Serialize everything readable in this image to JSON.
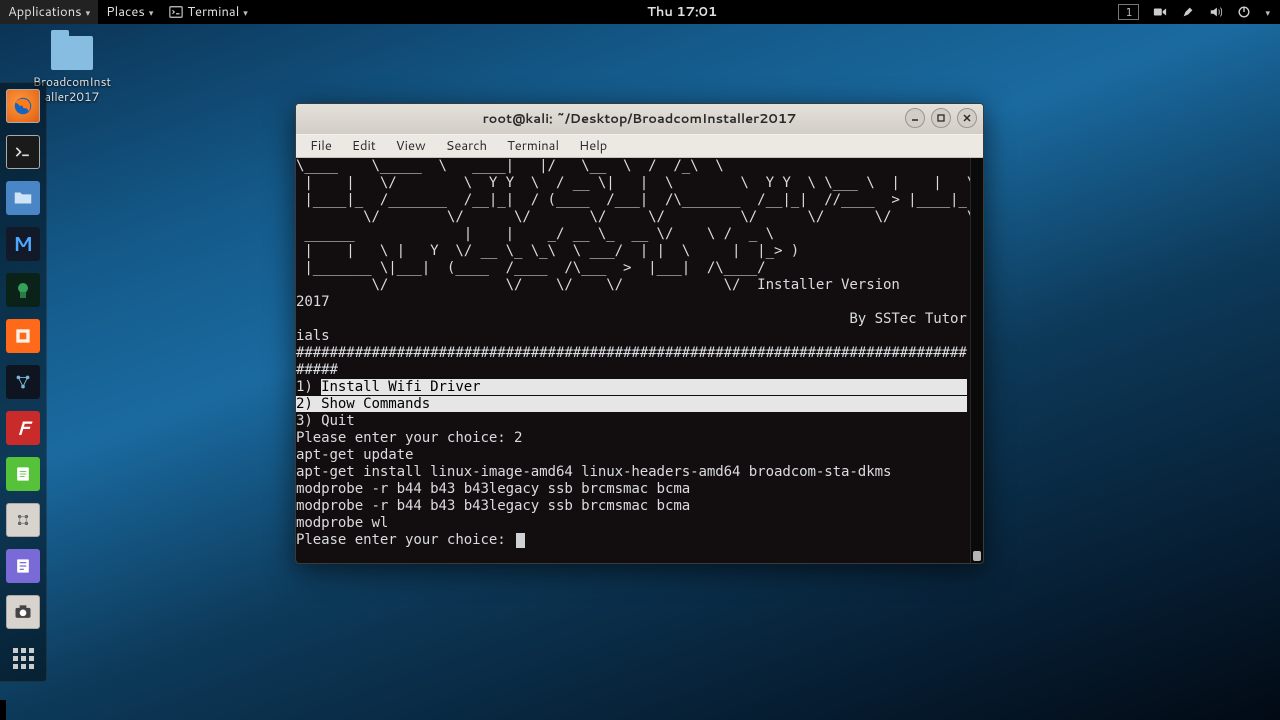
{
  "top_panel": {
    "apps": "Applications",
    "places": "Places",
    "terminal": "Terminal",
    "clock": "Thu 17:01",
    "workspace_badge": "1"
  },
  "desktop": {
    "folder_label": "BroadcomInstaller2017"
  },
  "window": {
    "title": "root@kali: ~/Desktop/BroadcomInstaller2017",
    "menus": [
      "File",
      "Edit",
      "View",
      "Search",
      "Terminal",
      "Help"
    ]
  },
  "term": {
    "ascii": [
      "\\____    \\_____  \\   ____|   |/   \\__  \\  /  /_\\  \\",
      " |    |   \\/        \\  Y Y  \\  / __ \\|   |  \\        \\  Y Y  \\ \\___ \\  |    |   \\/        \\  Y Y  \\",
      " |____|_  /_______  /__|_|  / (____  /___|  /\\_______  /__|_|  //____  > |____|_  /_______  /__|_|  /",
      "        \\/        \\/      \\/       \\/     \\/         \\/      \\/      \\/         \\/        \\/      \\/",
      " ______             |    |    _/ __ \\_  __ \\/    \\ /  _ \\",
      " |    |   \\ |   Y  \\/ __ \\_ \\_\\  \\ ___/  | |  \\     |  |_> )",
      " |_______ \\|___|  (____  /____  /\\___  >  |___|  /\\____/ "
    ],
    "banner_line": "         \\/              \\/    \\/    \\/            \\/  Installer Version ",
    "banner_year": "2017",
    "byline": "                                                                  By SSTec Tutor",
    "byline_wrap": "ials",
    "hash1": "################################################################################",
    "hash2": "#####",
    "opt1_prefix": "1) ",
    "opt1_text": "Install Wifi Driver",
    "opt2": "2) Show Commands",
    "opt3": "3) Quit",
    "prompt1": "Please enter your choice: 2",
    "cmds": [
      "apt-get update",
      "apt-get install linux-image-amd64 linux-headers-amd64 broadcom-sta-dkms",
      "modprobe -r b44 b43 b43legacy ssb brcmsmac bcma",
      "modprobe -r b44 b43 b43legacy ssb brcmsmac bcma",
      "modprobe wl"
    ],
    "prompt2": "Please enter your choice: "
  }
}
